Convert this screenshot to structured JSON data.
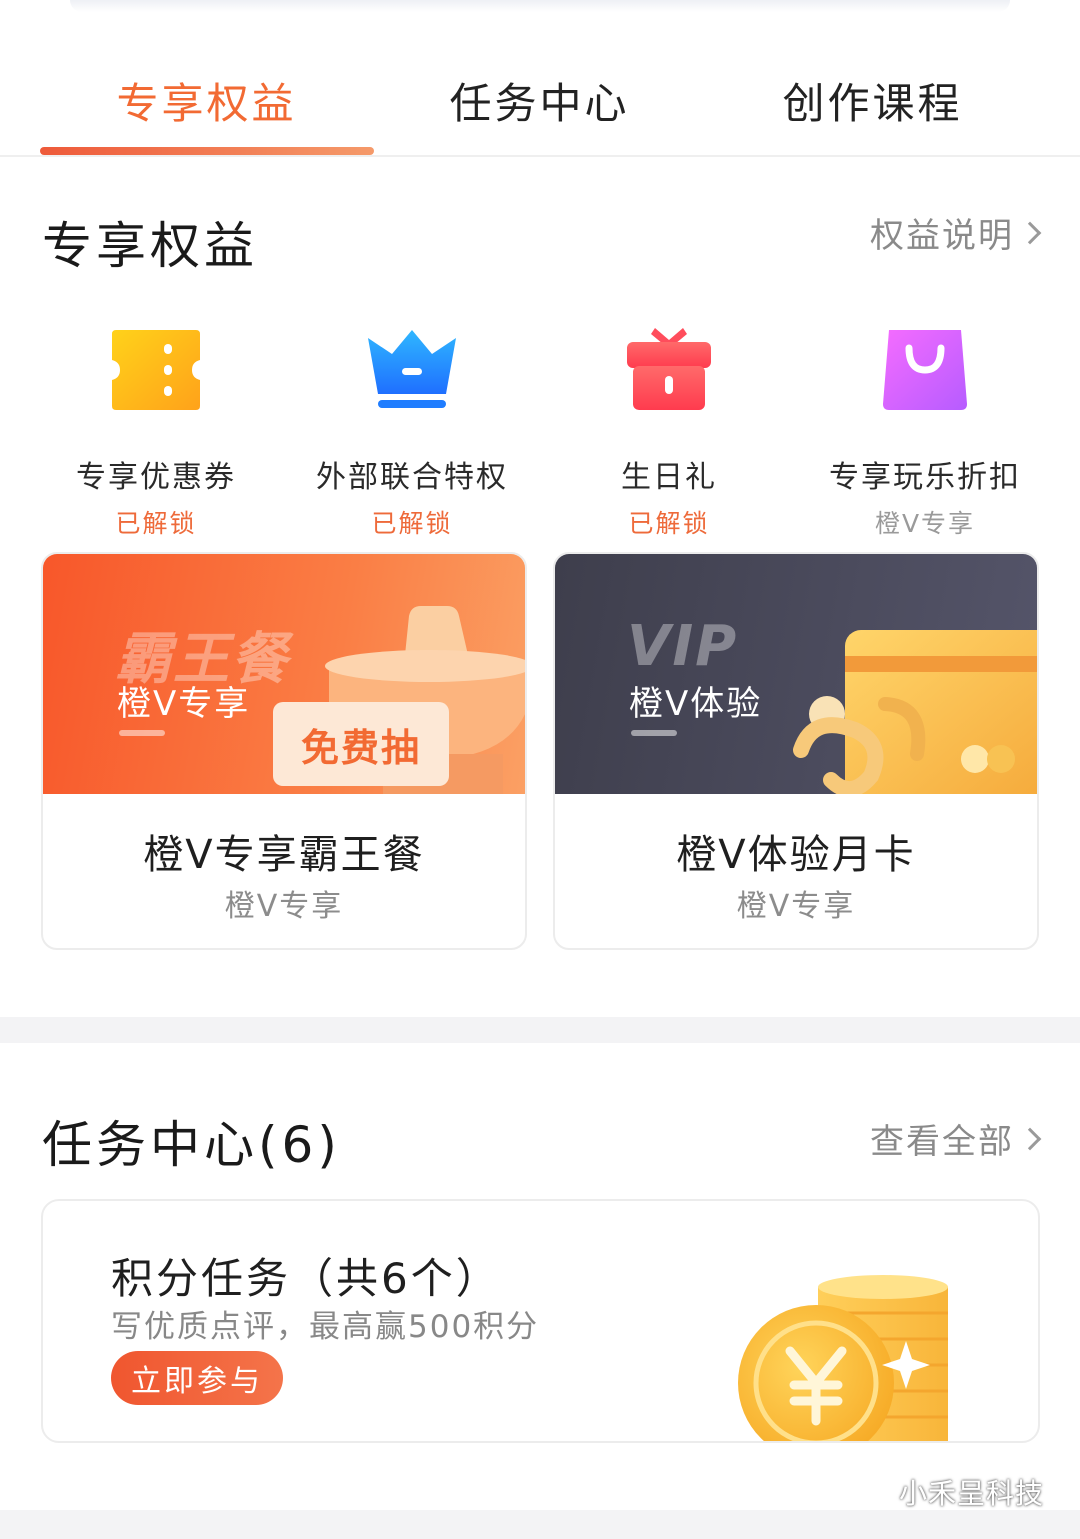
{
  "tabs": [
    {
      "label": "专享权益",
      "active": true
    },
    {
      "label": "任务中心",
      "active": false
    },
    {
      "label": "创作课程",
      "active": false
    }
  ],
  "benefits_section": {
    "title": "专享权益",
    "link": "权益说明",
    "items": [
      {
        "name": "专享优惠券",
        "status": "已解锁",
        "icon": "coupon-icon"
      },
      {
        "name": "外部联合特权",
        "status": "已解锁",
        "icon": "crown-icon"
      },
      {
        "name": "生日礼",
        "status": "已解锁",
        "icon": "gift-icon"
      },
      {
        "name": "专享玩乐折扣",
        "status": "橙V专享",
        "icon": "shopping-bag-icon"
      }
    ]
  },
  "promos": [
    {
      "banner_big": "霸王餐",
      "banner_small": "橙V专享",
      "badge": "免费抽",
      "title": "橙V专享霸王餐",
      "sub": "橙V专享"
    },
    {
      "banner_big": "VIP",
      "banner_small": "橙V体验",
      "title": "橙V体验月卡",
      "sub": "橙V专享"
    }
  ],
  "task_section": {
    "title": "任务中心(6)",
    "link": "查看全部",
    "card": {
      "title": "积分任务（共6个）",
      "desc": "写优质点评，最高赢500积分",
      "button": "立即参与"
    }
  },
  "watermark": "小禾呈科技",
  "colors": {
    "accent": "#f26a33",
    "muted": "#9a9a9a"
  }
}
